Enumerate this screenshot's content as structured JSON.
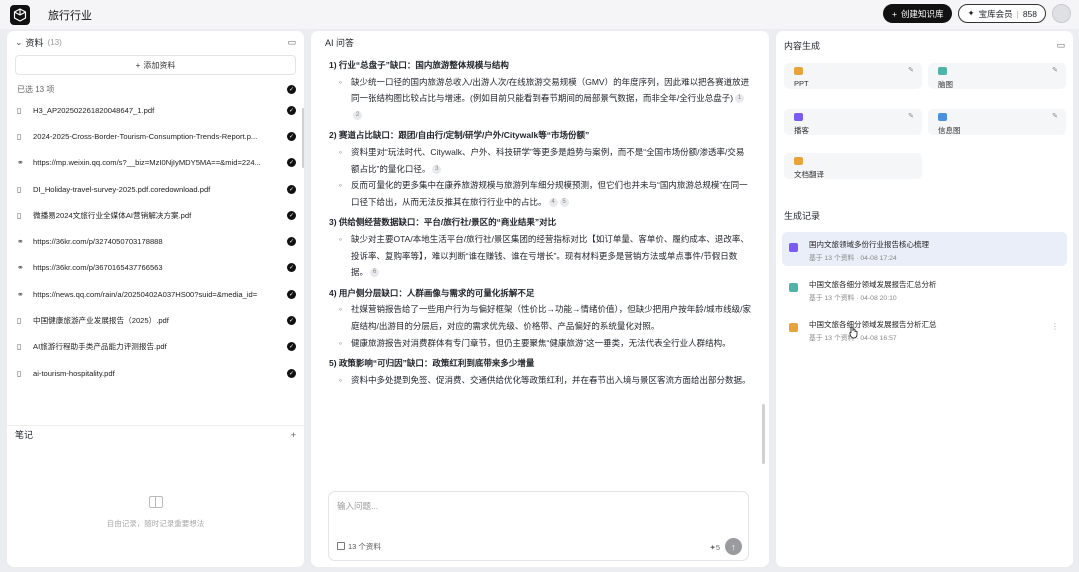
{
  "app": {
    "title": "旅行行业"
  },
  "topbar": {
    "create_kb_label": "创建知识库",
    "member_label": "宝库会员",
    "member_count": "858"
  },
  "sources": {
    "title": "资料",
    "count": "(13)",
    "add_label": "添加资料",
    "selected_label": "已选 13 项",
    "files": [
      {
        "icon": "file-icon",
        "name": "H3_AP202502261820048647_1.pdf"
      },
      {
        "icon": "file-icon",
        "name": "2024-2025-Cross-Border-Tourism-Consumption-Trends-Report.p..."
      },
      {
        "icon": "link-icon",
        "name": "https://mp.weixin.qq.com/s?__biz=MzI0NjIyMDY5MA==&mid=224..."
      },
      {
        "icon": "file-icon",
        "name": "DI_Holiday-travel-survey-2025.pdf.coredownload.pdf"
      },
      {
        "icon": "file-icon",
        "name": "微播易2024文旅行业全媒体AI营销解决方案.pdf"
      },
      {
        "icon": "link-icon",
        "name": "https://36kr.com/p/3274050703178888"
      },
      {
        "icon": "link-icon",
        "name": "https://36kr.com/p/3670165437766563"
      },
      {
        "icon": "link-icon",
        "name": "https://news.qq.com/rain/a/20250402A037HS00?suid=&media_id="
      },
      {
        "icon": "file-icon",
        "name": "中国健康旅游产业发展报告（2025）.pdf"
      },
      {
        "icon": "file-icon",
        "name": "AI旅游行程助手类产品能力评测报告.pdf"
      },
      {
        "icon": "file-icon",
        "name": "ai-tourism-hospitality.pdf"
      }
    ]
  },
  "notes": {
    "title": "笔记",
    "empty_text": "自由记录，随时记录重要想法"
  },
  "chat": {
    "title": "AI 问答",
    "blocks": [
      {
        "type": "h",
        "text": "1) 行业“总盘子”缺口：国内旅游整体规模与结构"
      },
      {
        "type": "b",
        "text": "缺少统一口径的国内旅游总收入/出游人次/在线旅游交易规模（GMV）的年度序列，因此难以把各赛道放进同一张结构图比较占比与增速。(例如目前只能看到春节期间的局部景气数据，而非全年/全行业总盘子)",
        "cites": [
          "1",
          "2"
        ]
      },
      {
        "type": "h",
        "text": "2) 赛道占比缺口：跟团/自由行/定制/研学/户外/Citywalk等“市场份额”"
      },
      {
        "type": "b",
        "text": "资料里对“玩法时代、Citywalk、户外、科技研学”等更多是趋势与案例，而不是“全国市场份额/渗透率/交易额占比”的量化口径。",
        "cites": [
          "3"
        ]
      },
      {
        "type": "b",
        "text": "反而可量化的更多集中在康养旅游规模与旅游列车细分规模预测，但它们也并未与“国内旅游总规模”在同一口径下给出，从而无法反推其在旅行行业中的占比。",
        "cites": [
          "4",
          "5"
        ]
      },
      {
        "type": "h",
        "text": "3) 供给侧经营数据缺口：平台/旅行社/景区的“商业结果”对比"
      },
      {
        "type": "b",
        "text": "缺少对主要OTA/本地生活平台/旅行社/景区集团的经营指标对比【如订单量、客单价、履约成本、退改率、投诉率、复购率等】，难以判断“谁在赚钱、谁在亏增长”。现有材料更多是营销方法或单点事件/节假日数据。",
        "cites": [
          "6"
        ]
      },
      {
        "type": "h",
        "text": "4) 用户侧分层缺口：人群画像与需求的可量化拆解不足"
      },
      {
        "type": "b",
        "text": "社媒营销报告给了一些用户行为与偏好框架（性价比→功能→情绪价值），但缺少把用户按年龄/城市线级/家庭结构/出游目的分层后，对应的需求优先级、价格带、产品偏好的系统量化对照。",
        "cites": []
      },
      {
        "type": "b",
        "text": "健康旅游报告对消费群体有专门章节，但仍主要聚焦“健康旅游”这一垂类，无法代表全行业人群结构。",
        "cites": []
      },
      {
        "type": "h",
        "text": "5) 政策影响“可归因”缺口：政策红利到底带来多少增量"
      },
      {
        "type": "b",
        "text": "资料中多处提到免签、促消费、交通供给优化等政策红利，并在春节出入境与景区客流方面给出部分数据。",
        "cites": []
      }
    ],
    "input_placeholder": "输入问题...",
    "source_chip": "13 个资料",
    "credits": "5"
  },
  "generate": {
    "title": "内容生成",
    "tools": [
      {
        "label": "PPT",
        "color": "#e8a33d"
      },
      {
        "label": "脑图",
        "color": "#4fb3a9"
      },
      {
        "label": "播客",
        "color": "#7a5af5"
      },
      {
        "label": "信息图",
        "color": "#4a90e2"
      },
      {
        "label": "文档翻译",
        "color": "#e8a33d"
      }
    ]
  },
  "records": {
    "title": "生成记录",
    "items": [
      {
        "title": "国内文旅领域多份行业报告核心梳理",
        "meta": "基于 13 个资料 · 04-08 17:24",
        "color": "#7a5af5"
      },
      {
        "title": "中国文旅各细分领域发展报告汇总分析",
        "meta": "基于 13 个资料 · 04-08 20:10",
        "color": "#4fb3a9"
      },
      {
        "title": "中国文旅各细分领域发展报告分析汇总",
        "meta": "基于 13 个资料 · 04-08 16:57",
        "color": "#e8a33d"
      }
    ]
  }
}
